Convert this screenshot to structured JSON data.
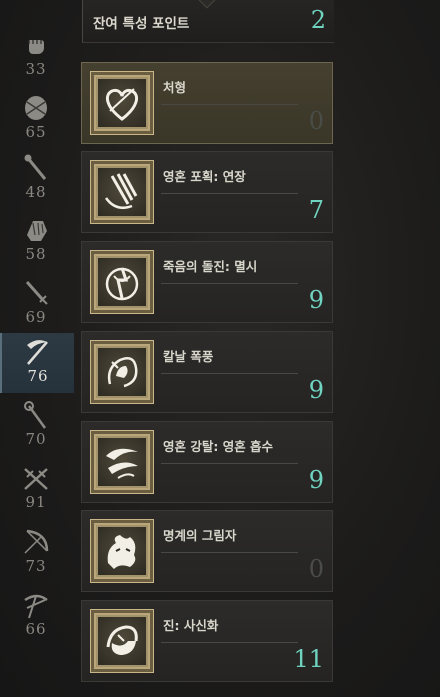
{
  "header": {
    "title": "잔여 특성 포인트",
    "points": "2"
  },
  "weapons": [
    {
      "icon": "fist-icon",
      "level": "33"
    },
    {
      "icon": "shield-icon",
      "level": "65"
    },
    {
      "icon": "mace-icon",
      "level": "48"
    },
    {
      "icon": "gauntlet-icon",
      "level": "58"
    },
    {
      "icon": "sword-icon",
      "level": "69"
    },
    {
      "icon": "scythe-icon",
      "level": "76",
      "active": true
    },
    {
      "icon": "staff-icon",
      "level": "70"
    },
    {
      "icon": "dual-blades-icon",
      "level": "91"
    },
    {
      "icon": "bow-icon",
      "level": "73"
    },
    {
      "icon": "crossbow-icon",
      "level": "66"
    }
  ],
  "traits": [
    {
      "name": "처형",
      "rank": "0",
      "icon": "heart-slash-icon",
      "selected": true
    },
    {
      "name": "영혼 포획: 연장",
      "rank": "7",
      "icon": "soul-capture-icon"
    },
    {
      "name": "죽음의 돌진: 멸시",
      "rank": "9",
      "icon": "death-rush-icon"
    },
    {
      "name": "칼날 폭풍",
      "rank": "9",
      "icon": "blade-storm-icon"
    },
    {
      "name": "영혼 강탈: 영혼 흡수",
      "rank": "9",
      "icon": "soul-drain-icon"
    },
    {
      "name": "명계의 그림자",
      "rank": "0",
      "icon": "underworld-shadow-icon"
    },
    {
      "name": "진: 사신화",
      "rank": "11",
      "icon": "reaper-form-icon"
    }
  ],
  "colors": {
    "accent": "#6fd3c0",
    "zero_rank": "#4a4c48",
    "text": "#d9d6cc"
  }
}
